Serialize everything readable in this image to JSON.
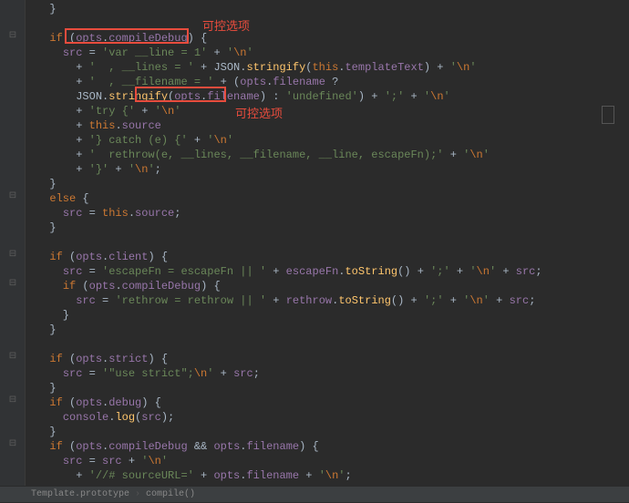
{
  "breadcrumb": {
    "a": "Template.prototype",
    "b": "compile()"
  },
  "annotations": {
    "a": "可控选项",
    "b": "可控选项"
  },
  "code": {
    "l0_a": "}",
    "l1": "",
    "l2_a": "if",
    "l2_b": " (",
    "l2_c": "opts",
    "l2_d": ".",
    "l2_e": "compileDebug",
    "l2_f": ") {",
    "l3_a": "  ",
    "l3_b": "src",
    "l3_c": " = ",
    "l3_d": "'var __line = 1'",
    "l3_e": " + ",
    "l3_f": "'",
    "l3_f2": "\\n",
    "l3_f3": "'",
    "l4_a": "    + ",
    "l4_b": "'  , __lines = '",
    "l4_c": " + JSON.",
    "l4_d": "stringify",
    "l4_e": "(",
    "l4_f": "this",
    "l4_g": ".",
    "l4_h": "templateText",
    "l4_i": ") + ",
    "l4_j": "'",
    "l4_j2": "\\n",
    "l4_j3": "'",
    "l5_a": "    + ",
    "l5_b": "'  , __filename = '",
    "l5_c": " + (",
    "l5_d": "opts",
    "l5_e": ".",
    "l5_f": "filename",
    "l5_g": " ?",
    "l6_a": "    JSON.",
    "l6_b": "stringify",
    "l6_c": "(",
    "l6_d": "opts",
    "l6_e": ".",
    "l6_f": "filename",
    "l6_g": ") : ",
    "l6_h": "'undefined'",
    "l6_i": ") + ",
    "l6_j": "';'",
    "l6_k": " + ",
    "l6_l": "'",
    "l6_l2": "\\n",
    "l6_l3": "'",
    "l7_a": "    + ",
    "l7_b": "'try {'",
    "l7_c": " + ",
    "l7_d": "'",
    "l7_d2": "\\n",
    "l7_d3": "'",
    "l8_a": "    + ",
    "l8_b": "this",
    "l8_c": ".",
    "l8_d": "source",
    "l9_a": "    + ",
    "l9_b": "'} catch (e) {'",
    "l9_c": " + ",
    "l9_d": "'",
    "l9_d2": "\\n",
    "l9_d3": "'",
    "l10_a": "    + ",
    "l10_b": "'  rethrow(e, __lines, __filename, __line, escapeFn);'",
    "l10_c": " + ",
    "l10_d": "'",
    "l10_d2": "\\n",
    "l10_d3": "'",
    "l11_a": "    + ",
    "l11_b": "'}'",
    "l11_c": " + ",
    "l11_d": "'",
    "l11_d2": "\\n",
    "l11_d3": "'",
    "l11_e": ";",
    "l12_a": "}",
    "l13_a": "else",
    "l13_b": " {",
    "l14_a": "  ",
    "l14_b": "src",
    "l14_c": " = ",
    "l14_d": "this",
    "l14_e": ".",
    "l14_f": "source",
    "l14_g": ";",
    "l15_a": "}",
    "l16": "",
    "l17_a": "if",
    "l17_b": " (",
    "l17_c": "opts",
    "l17_d": ".",
    "l17_e": "client",
    "l17_f": ") {",
    "l18_a": "  ",
    "l18_b": "src",
    "l18_c": " = ",
    "l18_d": "'escapeFn = escapeFn || '",
    "l18_e": " + ",
    "l18_f": "escapeFn",
    "l18_g": ".",
    "l18_h": "toString",
    "l18_i": "() + ",
    "l18_j": "';'",
    "l18_k": " + ",
    "l18_l": "'",
    "l18_l2": "\\n",
    "l18_l3": "'",
    "l18_m": " + ",
    "l18_n": "src",
    "l18_o": ";",
    "l19_a": "  ",
    "l19_b": "if",
    "l19_c": " (",
    "l19_d": "opts",
    "l19_e": ".",
    "l19_f": "compileDebug",
    "l19_g": ") {",
    "l20_a": "    ",
    "l20_b": "src",
    "l20_c": " = ",
    "l20_d": "'rethrow = rethrow || '",
    "l20_e": " + ",
    "l20_f": "rethrow",
    "l20_g": ".",
    "l20_h": "toString",
    "l20_i": "() + ",
    "l20_j": "';'",
    "l20_k": " + ",
    "l20_l": "'",
    "l20_l2": "\\n",
    "l20_l3": "'",
    "l20_m": " + ",
    "l20_n": "src",
    "l20_o": ";",
    "l21_a": "  }",
    "l22_a": "}",
    "l23": "",
    "l24_a": "if",
    "l24_b": " (",
    "l24_c": "opts",
    "l24_d": ".",
    "l24_e": "strict",
    "l24_f": ") {",
    "l25_a": "  ",
    "l25_b": "src",
    "l25_c": " = ",
    "l25_d": "'\"use strict\";",
    "l25_d2": "\\n",
    "l25_d3": "'",
    "l25_e": " + ",
    "l25_f": "src",
    "l25_g": ";",
    "l26_a": "}",
    "l27_a": "if",
    "l27_b": " (",
    "l27_c": "opts",
    "l27_d": ".",
    "l27_e": "debug",
    "l27_f": ") {",
    "l28_a": "  ",
    "l28_b": "console",
    "l28_c": ".",
    "l28_d": "log",
    "l28_e": "(",
    "l28_f": "src",
    "l28_g": ");",
    "l29_a": "}",
    "l30_a": "if",
    "l30_b": " (",
    "l30_c": "opts",
    "l30_d": ".",
    "l30_e": "compileDebug",
    "l30_f": " && ",
    "l30_g": "opts",
    "l30_h": ".",
    "l30_i": "filename",
    "l30_j": ") {",
    "l31_a": "  ",
    "l31_b": "src",
    "l31_c": " = ",
    "l31_d": "src",
    "l31_e": " + ",
    "l31_f": "'",
    "l31_f2": "\\n",
    "l31_f3": "'",
    "l32_a": "    + ",
    "l32_b": "'//# sourceURL='",
    "l32_c": " + ",
    "l32_d": "opts",
    "l32_e": ".",
    "l32_f": "filename",
    "l32_g": " + ",
    "l32_h": "'",
    "l32_h2": "\\n",
    "l32_h3": "'",
    "l32_i": ";"
  }
}
